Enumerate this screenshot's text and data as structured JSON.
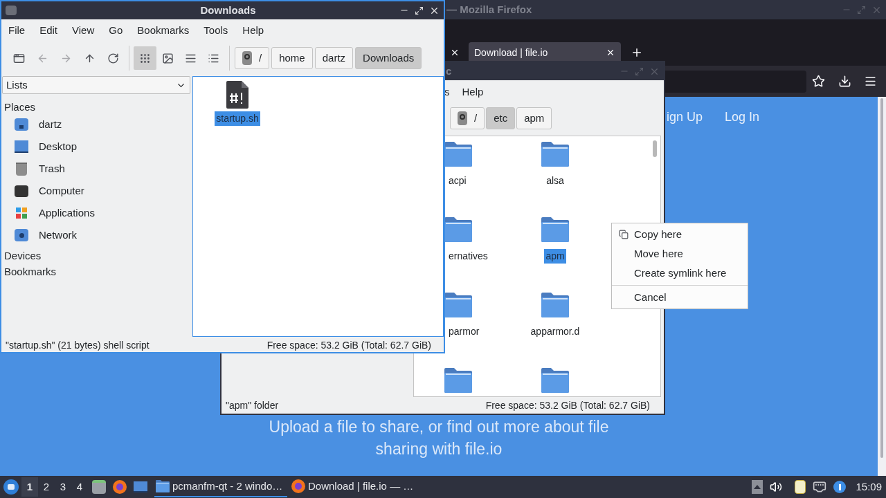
{
  "firefox": {
    "title": "— Mozilla Firefox",
    "tabs": [
      {
        "label": "Download | file.io",
        "selected": true
      }
    ],
    "nav_links": [
      "ign Up",
      "Log In"
    ],
    "tagline": "Upload a file to share, or find out more about file sharing with file.io"
  },
  "back_window": {
    "title": "c",
    "menu": [
      "s",
      "Help"
    ],
    "path": [
      {
        "label": "/",
        "kind": "root",
        "selected": false
      },
      {
        "label": "etc",
        "kind": "dir",
        "selected": true
      },
      {
        "label": "apm",
        "kind": "dir",
        "selected": false
      }
    ],
    "files": [
      {
        "name": "acpi",
        "selected": false
      },
      {
        "name": "alsa",
        "selected": false
      },
      {
        "name": "ernatives",
        "selected": false
      },
      {
        "name": "apm",
        "selected": true
      },
      {
        "name": "parmor",
        "selected": false
      },
      {
        "name": "apparmor.d",
        "selected": false
      },
      {
        "selected": false
      },
      {
        "selected": false
      }
    ],
    "status": "\"apm\" folder",
    "free_space": "Free space: 53.2 GiB (Total: 62.7 GiB)"
  },
  "front_window": {
    "title": "Downloads",
    "menu": [
      "File",
      "Edit",
      "View",
      "Go",
      "Bookmarks",
      "Tools",
      "Help"
    ],
    "nav_buttons": [
      {
        "kind": "new",
        "disabled": false
      },
      {
        "kind": "back",
        "disabled": true
      },
      {
        "kind": "forward",
        "disabled": true
      },
      {
        "kind": "up",
        "disabled": false
      },
      {
        "kind": "reload",
        "disabled": false
      }
    ],
    "view_buttons": [
      {
        "kind": "icons",
        "selected": true
      },
      {
        "kind": "thumbnails",
        "selected": false
      },
      {
        "kind": "compact",
        "selected": false
      },
      {
        "kind": "details",
        "selected": false
      }
    ],
    "path": [
      {
        "label": "/",
        "kind": "root",
        "selected": false
      },
      {
        "label": "home",
        "kind": "dir",
        "selected": false
      },
      {
        "label": "dartz",
        "kind": "dir",
        "selected": false
      },
      {
        "label": "Downloads",
        "kind": "dir",
        "selected": true
      }
    ],
    "side_pane": {
      "mode": "Lists",
      "sections": [
        {
          "title": "Places",
          "items": [
            {
              "label": "dartz",
              "kind": "home"
            },
            {
              "label": "Desktop",
              "kind": "desktop"
            },
            {
              "label": "Trash",
              "kind": "trash"
            },
            {
              "label": "Computer",
              "kind": "computer"
            },
            {
              "label": "Applications",
              "kind": "apps"
            },
            {
              "label": "Network",
              "kind": "network"
            }
          ]
        },
        {
          "title": "Devices"
        },
        {
          "title": "Bookmarks"
        }
      ]
    },
    "files": [
      {
        "name": "startup.sh",
        "selected": true
      }
    ],
    "status": "\"startup.sh\" (21 bytes) shell script",
    "free_space": "Free space: 53.2 GiB (Total: 62.7 GiB)"
  },
  "context_menu": [
    {
      "label": "Copy here",
      "kind": "copy",
      "separator_before": false
    },
    {
      "label": "Move here",
      "kind": "plain",
      "separator_before": false
    },
    {
      "label": "Create symlink here",
      "kind": "plain",
      "separator_before": false
    },
    {
      "label": "Cancel",
      "kind": "plain",
      "separator_before": true
    }
  ],
  "taskbar": {
    "desktops": [
      {
        "label": "1",
        "selected": true
      },
      {
        "label": "2",
        "selected": false
      },
      {
        "label": "3",
        "selected": false
      },
      {
        "label": "4",
        "selected": false
      }
    ],
    "tasks": [
      {
        "label": "pcmanfm-qt - 2 windo…",
        "kind": "folder",
        "selected": true
      },
      {
        "label": "Download | file.io — …",
        "kind": "browser",
        "selected": false
      }
    ],
    "clock": "15:09"
  }
}
